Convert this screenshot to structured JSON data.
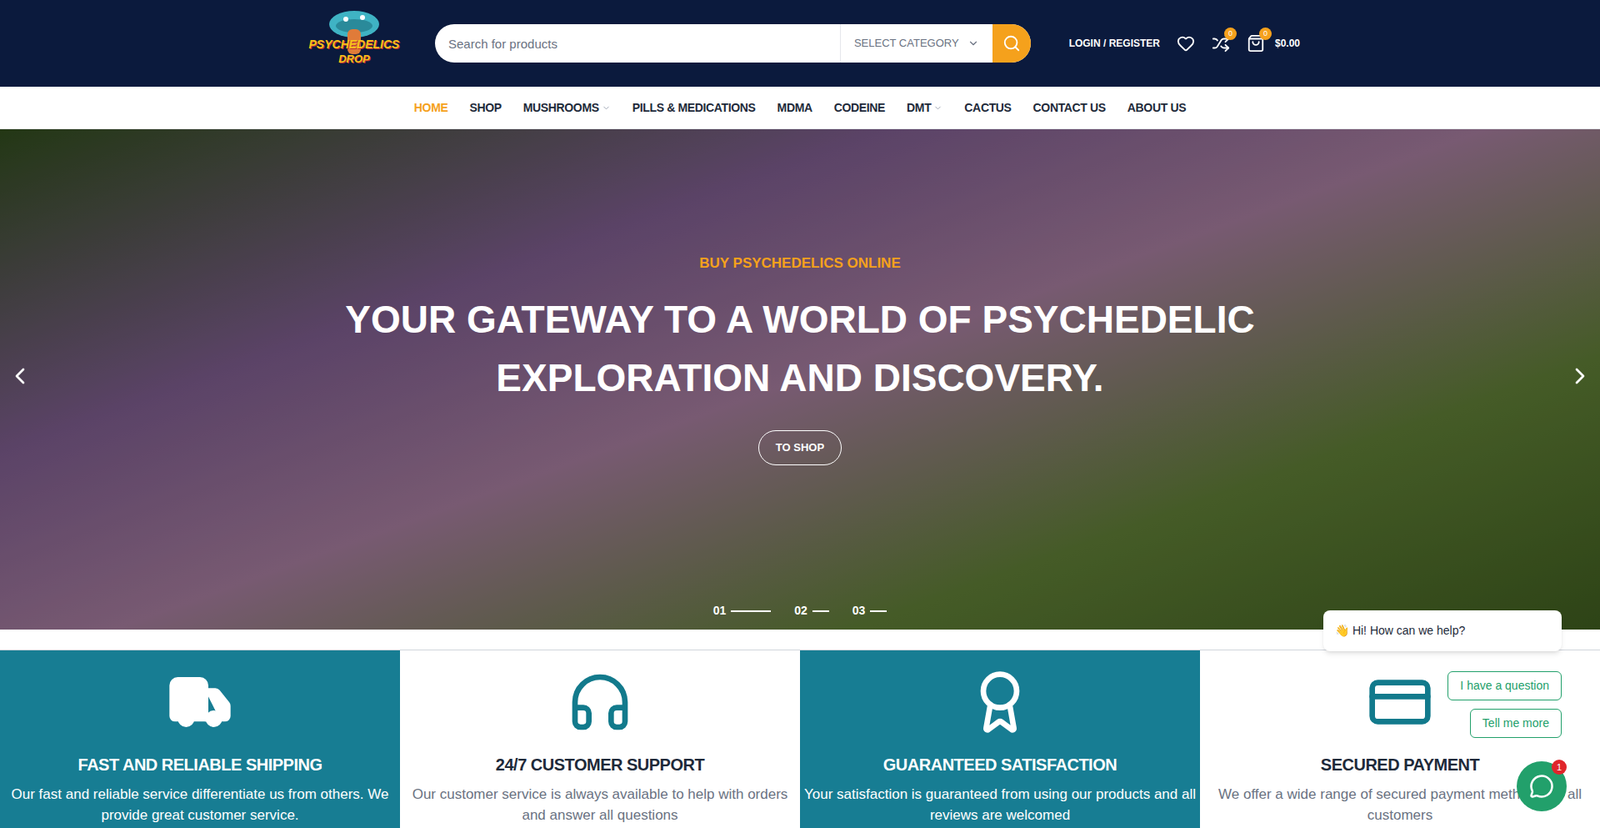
{
  "logo": {
    "line1": "PSYCHEDELICS",
    "line2": "DROP"
  },
  "search": {
    "placeholder": "Search for products",
    "category": "SELECT CATEGORY"
  },
  "account": {
    "login": "LOGIN / REGISTER",
    "compare_count": "0",
    "cart_count": "0",
    "cart_total": "$0.00"
  },
  "nav": [
    {
      "label": "HOME",
      "selected": true,
      "dropdown": false
    },
    {
      "label": "SHOP",
      "selected": false,
      "dropdown": false
    },
    {
      "label": "MUSHROOMS",
      "selected": false,
      "dropdown": true
    },
    {
      "label": "PILLS & MEDICATIONS",
      "selected": false,
      "dropdown": false
    },
    {
      "label": "MDMA",
      "selected": false,
      "dropdown": false
    },
    {
      "label": "CODEINE",
      "selected": false,
      "dropdown": false
    },
    {
      "label": "DMT",
      "selected": false,
      "dropdown": true
    },
    {
      "label": "CACTUS",
      "selected": false,
      "dropdown": false
    },
    {
      "label": "CONTACT US",
      "selected": false,
      "dropdown": false
    },
    {
      "label": "ABOUT US",
      "selected": false,
      "dropdown": false
    }
  ],
  "hero": {
    "subtitle": "BUY PSYCHEDELICS ONLINE",
    "title": "YOUR GATEWAY TO A WORLD OF PSYCHEDELIC EXPLORATION AND DISCOVERY.",
    "button": "TO SHOP",
    "slides": [
      {
        "label": "01",
        "selected": true
      },
      {
        "label": "02",
        "selected": false
      },
      {
        "label": "03",
        "selected": false
      }
    ]
  },
  "features": [
    {
      "kind": "shipping",
      "title": "FAST AND RELIABLE SHIPPING",
      "text": "Our fast and reliable service differentiate us from others. We provide great customer service.",
      "highlighted": true
    },
    {
      "kind": "support",
      "title": "24/7 CUSTOMER SUPPORT",
      "text": "Our customer service is always available to help with orders and answer all questions",
      "highlighted": false
    },
    {
      "kind": "satisfaction",
      "title": "GUARANTEED SATISFACTION",
      "text": "Your satisfaction is guaranteed from using our products and all reviews are welcomed",
      "highlighted": true
    },
    {
      "kind": "payment",
      "title": "SECURED PAYMENT",
      "text": "We offer a wide range of secured payment methods for all customers",
      "highlighted": false
    }
  ],
  "chat": {
    "greeting": "👋 Hi! How can we help?",
    "options": [
      "I have a question",
      "Tell me more"
    ],
    "badge": "1"
  }
}
